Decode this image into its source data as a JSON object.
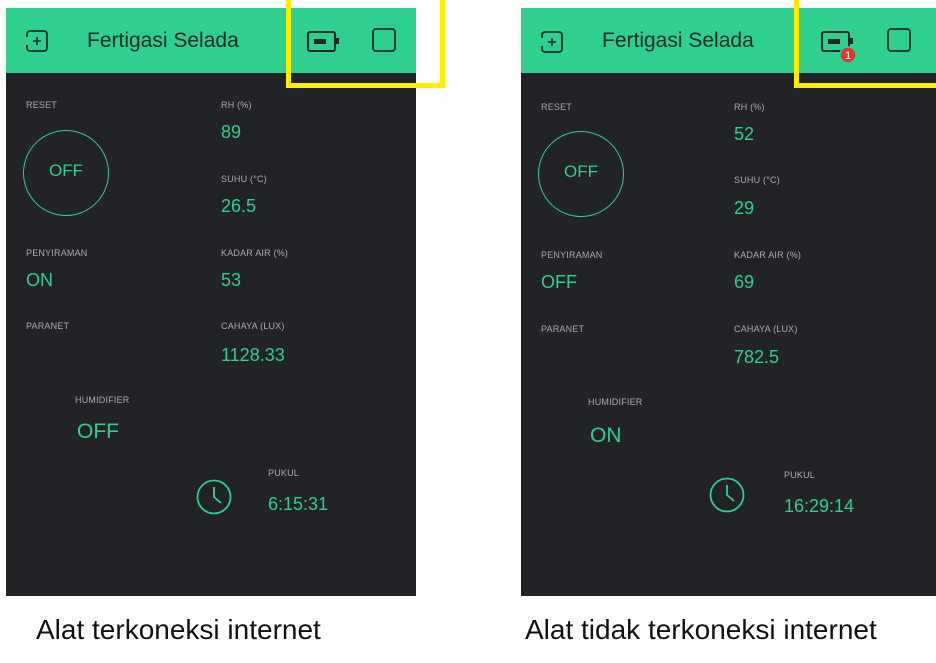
{
  "app": {
    "title": "Fertigasi Selada"
  },
  "screens": [
    {
      "caption": "Alat terkoneksi internet",
      "header": {
        "title": "Fertigasi Selada",
        "notification_count": ""
      },
      "widgets": {
        "reset": {
          "label": "RESET",
          "value": "OFF"
        },
        "rh": {
          "label": "RH (%)",
          "value": "89"
        },
        "suhu": {
          "label": "SUHU (°C)",
          "value": "26.5"
        },
        "penyiraman": {
          "label": "PENYIRAMAN",
          "value": "ON"
        },
        "kadar_air": {
          "label": "KADAR AIR (%)",
          "value": "53"
        },
        "paranet": {
          "label": "PARANET",
          "value": ""
        },
        "cahaya": {
          "label": "CAHAYA (LUX)",
          "value": "1128.33"
        },
        "humidifier": {
          "label": "HUMIDIFIER",
          "value": "OFF"
        },
        "pukul": {
          "label": "PUKUL",
          "value": "6:15:31"
        }
      }
    },
    {
      "caption": "Alat tidak terkoneksi internet",
      "header": {
        "title": "Fertigasi Selada",
        "notification_count": "1"
      },
      "widgets": {
        "reset": {
          "label": "RESET",
          "value": "OFF"
        },
        "rh": {
          "label": "RH (%)",
          "value": "52"
        },
        "suhu": {
          "label": "SUHU (°C)",
          "value": "29"
        },
        "penyiraman": {
          "label": "PENYIRAMAN",
          "value": "OFF"
        },
        "kadar_air": {
          "label": "KADAR AIR (%)",
          "value": "69"
        },
        "paranet": {
          "label": "PARANET",
          "value": ""
        },
        "cahaya": {
          "label": "CAHAYA (LUX)",
          "value": "782.5"
        },
        "humidifier": {
          "label": "HUMIDIFIER",
          "value": "ON"
        },
        "pukul": {
          "label": "PUKUL",
          "value": "16:29:14"
        }
      }
    }
  ],
  "colors": {
    "accent": "#2fcf8e",
    "background": "#222326",
    "label": "#a8adb0",
    "highlight": "#ffee00",
    "badge": "#d93a34"
  },
  "icons": {
    "back": "back-icon",
    "device": "device-icon",
    "frame": "square-icon",
    "clock": "clock-icon"
  }
}
